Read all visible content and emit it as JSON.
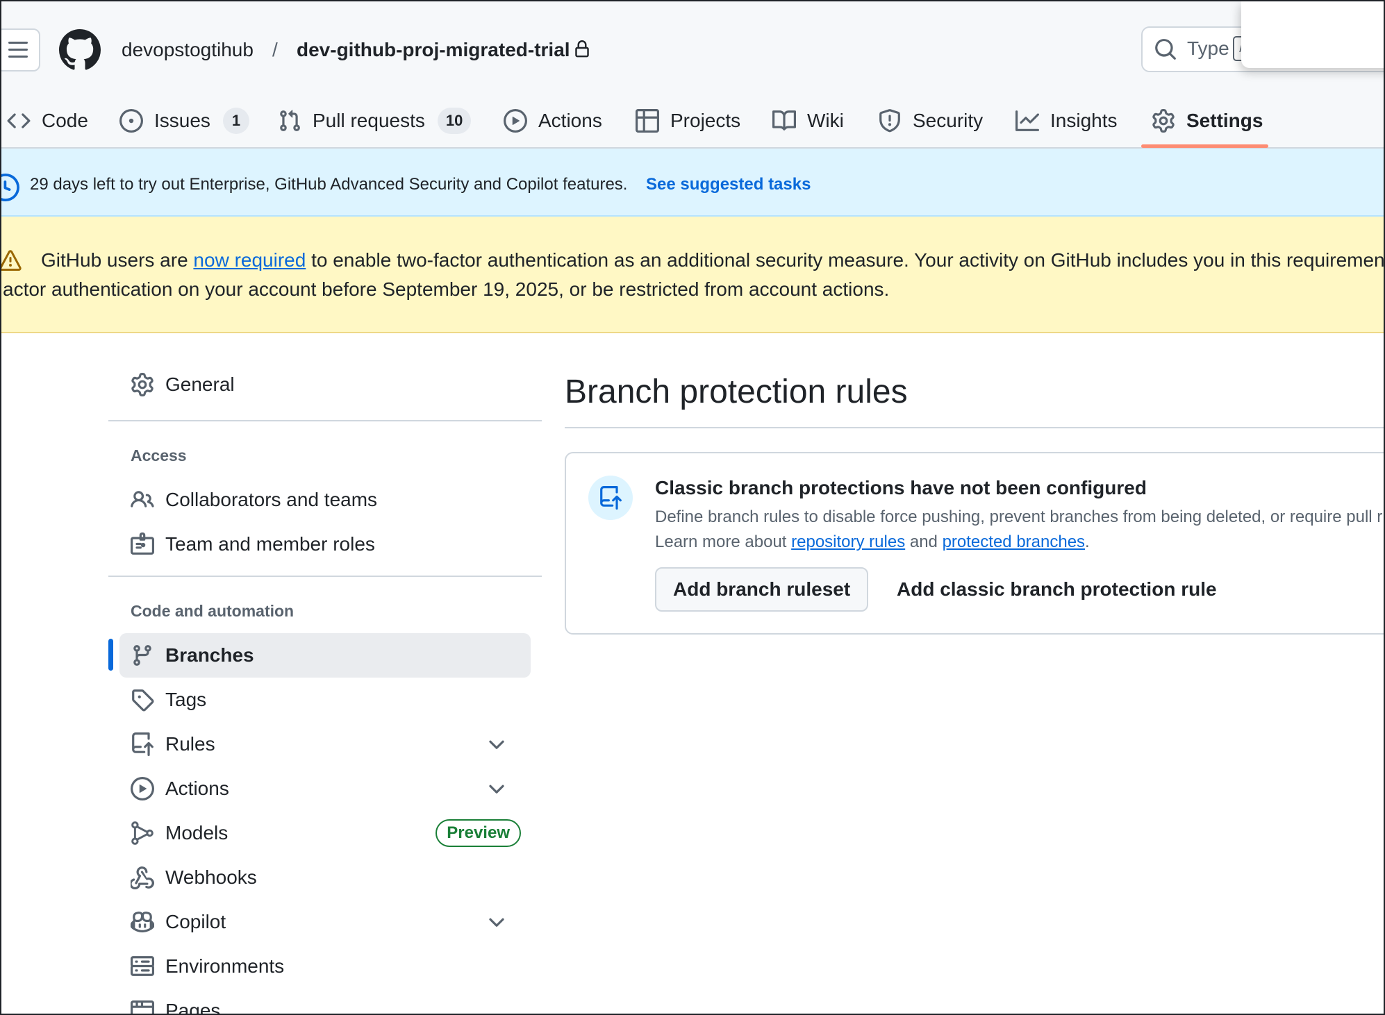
{
  "header": {
    "owner": "devopstogtihub",
    "separator": "/",
    "repo": "dev-github-proj-migrated-trial",
    "search_placeholder": "Type",
    "search_shortcut": "/"
  },
  "tabs": [
    {
      "label": "Code",
      "icon": "code-icon"
    },
    {
      "label": "Issues",
      "icon": "issue-opened-icon",
      "count": "1"
    },
    {
      "label": "Pull requests",
      "icon": "git-pull-request-icon",
      "count": "10"
    },
    {
      "label": "Actions",
      "icon": "play-icon"
    },
    {
      "label": "Projects",
      "icon": "table-icon"
    },
    {
      "label": "Wiki",
      "icon": "book-icon"
    },
    {
      "label": "Security",
      "icon": "shield-icon"
    },
    {
      "label": "Insights",
      "icon": "graph-icon"
    },
    {
      "label": "Settings",
      "icon": "gear-icon",
      "selected": true
    }
  ],
  "trial_banner": {
    "text": "29 days left to try out Enterprise, GitHub Advanced Security and Copilot features.",
    "link": "See suggested tasks"
  },
  "warning_banner": {
    "line1_before": "GitHub users are ",
    "line1_link": "now required",
    "line1_after": " to enable two-factor authentication as an additional security measure. Your activity on GitHub includes you in this requiremen",
    "line2": "actor authentication on your account before September 19, 2025, or be restricted from account actions."
  },
  "sidebar": {
    "general": "General",
    "access_heading": "Access",
    "access_items": [
      "Collaborators and teams",
      "Team and member roles"
    ],
    "code_heading": "Code and automation",
    "items": [
      {
        "label": "Branches",
        "active": true
      },
      {
        "label": "Tags"
      },
      {
        "label": "Rules",
        "expandable": true
      },
      {
        "label": "Actions",
        "expandable": true
      },
      {
        "label": "Models",
        "badge": "Preview"
      },
      {
        "label": "Webhooks"
      },
      {
        "label": "Copilot",
        "expandable": true
      },
      {
        "label": "Environments"
      },
      {
        "label": "Pages"
      }
    ]
  },
  "main": {
    "title": "Branch protection rules",
    "card": {
      "title": "Classic branch protections have not been configured",
      "description": "Define branch rules to disable force pushing, prevent branches from being deleted, or require pull r",
      "learn_prefix": "Learn more about ",
      "link_rules": "repository rules",
      "learn_and": " and ",
      "link_branches": "protected branches",
      "learn_suffix": ".",
      "primary_button": "Add branch ruleset",
      "secondary_button": "Add classic branch protection rule"
    }
  },
  "colors": {
    "accent": "#0969da",
    "selected_tab_underline": "#fd8c73",
    "trial_banner_bg": "#ddf4ff",
    "warning_banner_bg": "#fff8c5",
    "preview_badge": "#1a7f37"
  }
}
